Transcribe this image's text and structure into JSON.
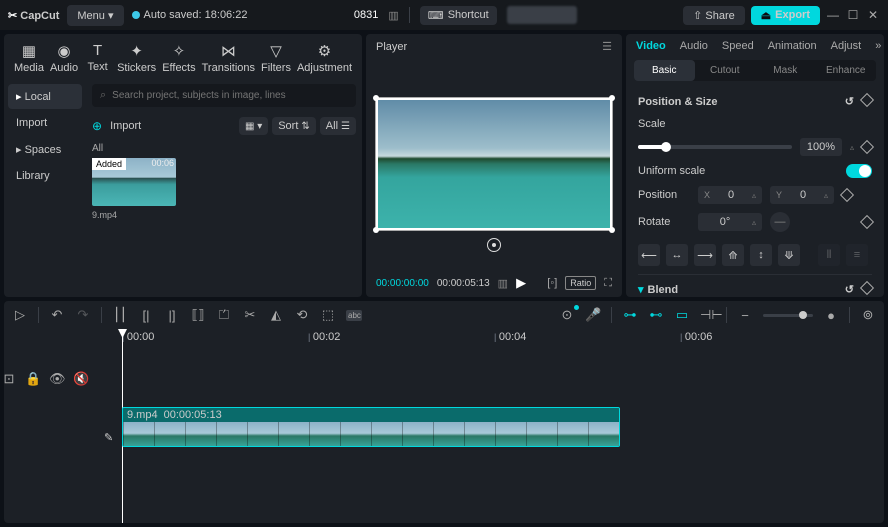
{
  "titlebar": {
    "app": "CapCut",
    "menu": "Menu",
    "autosave": "Auto saved: 18:06:22",
    "project": "0831",
    "shortcut": "Shortcut",
    "share": "Share",
    "export": "Export"
  },
  "toolTabs": [
    {
      "label": "Media",
      "icon": "▦"
    },
    {
      "label": "Audio",
      "icon": "◉"
    },
    {
      "label": "Text",
      "icon": "T"
    },
    {
      "label": "Stickers",
      "icon": "✦"
    },
    {
      "label": "Effects",
      "icon": "✧"
    },
    {
      "label": "Transitions",
      "icon": "⋈"
    },
    {
      "label": "Filters",
      "icon": "▽"
    },
    {
      "label": "Adjustment",
      "icon": "⚙"
    }
  ],
  "sideNav": [
    "Local",
    "Import",
    "Spaces",
    "Library"
  ],
  "media": {
    "searchPlaceholder": "Search project, subjects in image, lines",
    "import": "Import",
    "sort": "Sort",
    "all": "All",
    "filterLabel": "All",
    "thumb": {
      "badge": "Added",
      "dur": "00:06",
      "name": "9.mp4"
    }
  },
  "player": {
    "title": "Player",
    "t1": "00:00:00:00",
    "t2": "00:00:05:13",
    "ratio": "Ratio"
  },
  "inspector": {
    "tabs": [
      "Video",
      "Audio",
      "Speed",
      "Animation",
      "Adjust"
    ],
    "subtabs": [
      "Basic",
      "Cutout",
      "Mask",
      "Enhance"
    ],
    "posSize": "Position & Size",
    "scale": "Scale",
    "scaleVal": "100%",
    "uniform": "Uniform scale",
    "position": "Position",
    "posX": "0",
    "posY": "0",
    "rotate": "Rotate",
    "rotateVal": "0°",
    "blend": "Blend"
  },
  "timeline": {
    "ticks": [
      "00:00",
      "00:02",
      "00:04",
      "00:06"
    ],
    "clipName": "9.mp4",
    "clipDur": "00:00:05:13"
  }
}
